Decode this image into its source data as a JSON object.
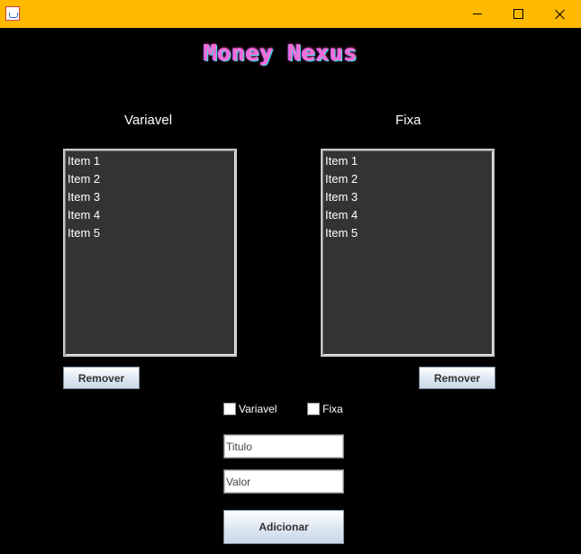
{
  "window": {
    "controls": {
      "minimize_icon": "minimize-icon",
      "maximize_icon": "maximize-icon",
      "close_icon": "close-icon"
    },
    "titlebar_color": "#ffb900"
  },
  "logo": {
    "text": "Money Nexus"
  },
  "variavel": {
    "title": "Variavel",
    "items": [
      "Item 1",
      "Item 2",
      "Item 3",
      "Item 4",
      "Item 5"
    ],
    "remove_label": "Remover"
  },
  "fixa": {
    "title": "Fixa",
    "items": [
      "Item 1",
      "Item 2",
      "Item 3",
      "Item 4",
      "Item 5"
    ],
    "remove_label": "Remover"
  },
  "form": {
    "checkbox_variavel": "Variavel",
    "checkbox_fixa": "Fixa",
    "titulo_value": "Titulo",
    "valor_value": "Valor",
    "add_label": "Adicionar"
  }
}
